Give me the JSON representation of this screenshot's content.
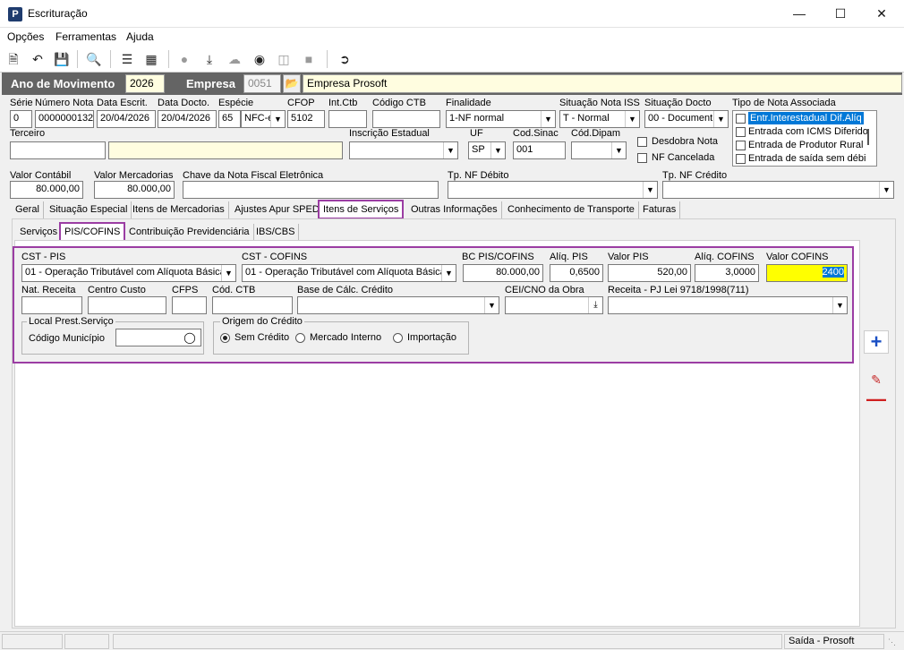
{
  "window": {
    "title": "Escrituração",
    "app_icon": "P"
  },
  "menu": [
    "Opções",
    "Ferramentas",
    "Ajuda"
  ],
  "header": {
    "ano_label": "Ano de Movimento",
    "ano_value": "2026",
    "empresa_label": "Empresa",
    "empresa_code": "0051",
    "empresa_name": "Empresa Prosoft"
  },
  "doc": {
    "serie_label": "Série",
    "serie": "0",
    "numero_label": "Número Nota",
    "numero": "0000000132",
    "data_escrit_label": "Data Escrit.",
    "data_escrit": "20/04/2026",
    "data_docto_label": "Data Docto.",
    "data_docto": "20/04/2026",
    "especie_label": "Espécie",
    "especie_code": "65",
    "especie_name": "NFC-e",
    "cfop_label": "CFOP",
    "cfop": "5102",
    "intctb_label": "Int.Ctb",
    "intctb": "",
    "codigo_ctb_label": "Código CTB",
    "codigo_ctb": "",
    "finalidade_label": "Finalidade",
    "finalidade": "1-NF normal",
    "sit_iss_label": "Situação Nota ISS",
    "sit_iss": "T - Normal",
    "sit_docto_label": "Situação Docto",
    "sit_docto": "00 - Document",
    "tipo_nota_label": "Tipo de Nota Associada",
    "tipo_nota_items": [
      "Entr.Interestadual Dif.Alíq",
      "Entrada com ICMS Diferido",
      "Entrada de Produtor Rural",
      "Entrada de saída sem débi"
    ],
    "terceiro_label": "Terceiro",
    "terceiro_code": "",
    "terceiro_name": "",
    "insc_label": "Inscrição Estadual",
    "insc": "",
    "uf_label": "UF",
    "uf": "SP",
    "sinac_label": "Cod.Sinac",
    "sinac": "001",
    "dipam_label": "Cód.Dipam",
    "dipam": "",
    "desdobra_label": "Desdobra Nota",
    "cancelada_label": "NF Cancelada",
    "valor_contabil_label": "Valor Contábil",
    "valor_contabil": "80.000,00",
    "valor_merc_label": "Valor Mercadorias",
    "valor_merc": "80.000,00",
    "chave_label": "Chave da Nota Fiscal Eletrônica",
    "chave": "",
    "tp_debito_label": "Tp. NF Débito",
    "tp_debito": "",
    "tp_credito_label": "Tp. NF Crédito",
    "tp_credito": ""
  },
  "main_tabs": [
    "Geral",
    "Situação Especial",
    "Itens de Mercadorias",
    "Ajustes Apur SPED",
    "Itens de Serviços",
    "Outras Informações",
    "Conhecimento de Transporte",
    "Faturas"
  ],
  "sub_tabs": [
    "Serviços",
    "PIS/COFINS",
    "Contribuição Previdenciária",
    "IBS/CBS"
  ],
  "pis": {
    "cst_pis_label": "CST - PIS",
    "cst_pis": "01 - Operação Tributável com Alíquota Básica",
    "cst_cofins_label": "CST - COFINS",
    "cst_cofins": "01 - Operação Tributável com Alíquota Básica",
    "bc_label": "BC PIS/COFINS",
    "bc": "80.000,00",
    "aliq_pis_label": "Alíq. PIS",
    "aliq_pis": "0,6500",
    "valor_pis_label": "Valor PIS",
    "valor_pis": "520,00",
    "aliq_cofins_label": "Alíq. COFINS",
    "aliq_cofins": "3,0000",
    "valor_cofins_label": "Valor COFINS",
    "valor_cofins": "2400",
    "nat_receita_label": "Nat. Receita",
    "centro_custo_label": "Centro Custo",
    "cfps_label": "CFPS",
    "cod_ctb_label": "Cód. CTB",
    "base_credito_label": "Base de Cálc. Crédito",
    "cei_label": "CEI/CNO da Obra",
    "receita_label": "Receita - PJ Lei 9718/1998(711)",
    "local_label": "Local Prest.Serviço",
    "codigo_municipio_label": "Código Município",
    "origem_label": "Origem do Crédito",
    "origem_options": [
      "Sem Crédito",
      "Mercado Interno",
      "Importação"
    ]
  },
  "status": {
    "text": "Saída - Prosoft"
  },
  "colors": {
    "highlight": "#9b3da3",
    "header_bg": "#646464",
    "yellow": "#ffff00",
    "selection": "#0078d7"
  }
}
